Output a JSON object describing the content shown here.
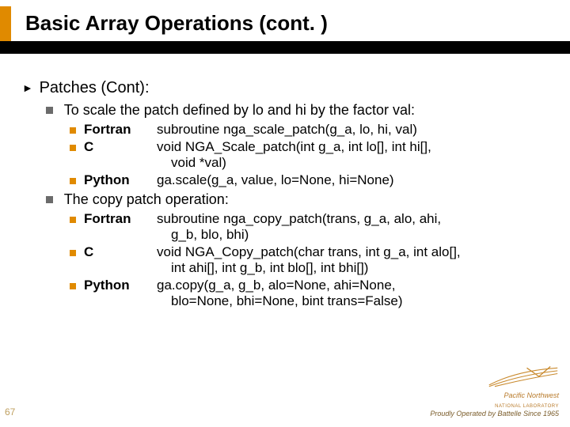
{
  "title": "Basic Array Operations (cont. )",
  "page_number": "67",
  "section": {
    "heading": "Patches (Cont):",
    "items": [
      {
        "text": "To scale the patch defined by lo and hi by the factor val:",
        "calls": [
          {
            "lang": "Fortran",
            "sig": "subroutine nga_scale_patch(g_a, lo, hi, val)"
          },
          {
            "lang": "C",
            "sig": "void NGA_Scale_patch(int g_a, int lo[], int hi[],",
            "cont": "void *val)"
          },
          {
            "lang": "Python",
            "sig": "ga.scale(g_a, value, lo=None, hi=None)"
          }
        ]
      },
      {
        "text": "The copy patch operation:",
        "calls": [
          {
            "lang": "Fortran",
            "sig": "subroutine nga_copy_patch(trans, g_a, alo, ahi,",
            "cont": "g_b, blo, bhi)"
          },
          {
            "lang": "C",
            "sig": "void NGA_Copy_patch(char trans, int g_a, int alo[],",
            "cont": "int ahi[], int g_b, int blo[], int bhi[])"
          },
          {
            "lang": "Python",
            "sig": "ga.copy(g_a, g_b, alo=None, ahi=None,",
            "cont": "blo=None, bhi=None, bint trans=False)"
          }
        ]
      }
    ]
  },
  "footer": {
    "lab_line1": "Pacific Northwest",
    "lab_line2": "NATIONAL LABORATORY",
    "tagline": "Proudly Operated by Battelle Since 1965"
  }
}
